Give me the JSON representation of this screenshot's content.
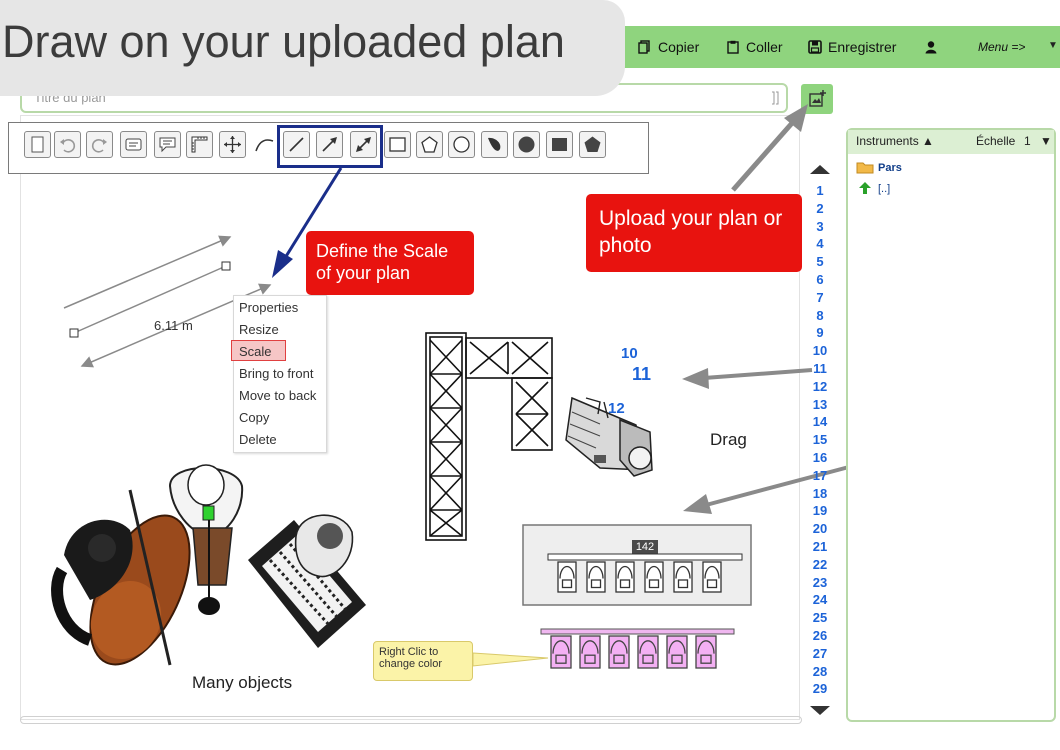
{
  "banner": {
    "text": "Draw on your uploaded plan"
  },
  "toolbar_top": {
    "copy_label": "Copier",
    "paste_label": "Coller",
    "save_label": "Enregistrer",
    "menu_label": "Menu =>"
  },
  "title_input": {
    "placeholder": "Titre du plan"
  },
  "callouts": {
    "scale": "Define the Scale of your plan",
    "upload": "Upload your plan or photo"
  },
  "context_menu": {
    "items": [
      "Properties",
      "Resize",
      "Scale",
      "Bring to front",
      "Move to back",
      "Copy",
      "Delete"
    ],
    "selected": "Scale"
  },
  "canvas": {
    "dimension": "6.11 m",
    "drag_label": "Drag",
    "many_label": "Many objects",
    "tooltip": "Right Clic to change color",
    "num_10": "10",
    "num_11": "11",
    "num_12": "12",
    "group_number": "142"
  },
  "ruler": {
    "numbers": [
      "1",
      "2",
      "3",
      "4",
      "5",
      "6",
      "7",
      "8",
      "9",
      "10",
      "11",
      "12",
      "13",
      "14",
      "15",
      "16",
      "17",
      "18",
      "19",
      "20",
      "21",
      "22",
      "23",
      "24",
      "25",
      "26",
      "27",
      "28",
      "29"
    ]
  },
  "panel": {
    "instruments_label": "Instruments",
    "scale_label": "Échelle",
    "scale_value": "1",
    "folder_name": "Pars",
    "up_folder": "[..]"
  },
  "colors": {
    "accent_green": "#8fd47e",
    "callout_red": "#e8130f",
    "highlight_navy": "#1a2e8a",
    "ruler_blue": "#1c63d8"
  }
}
